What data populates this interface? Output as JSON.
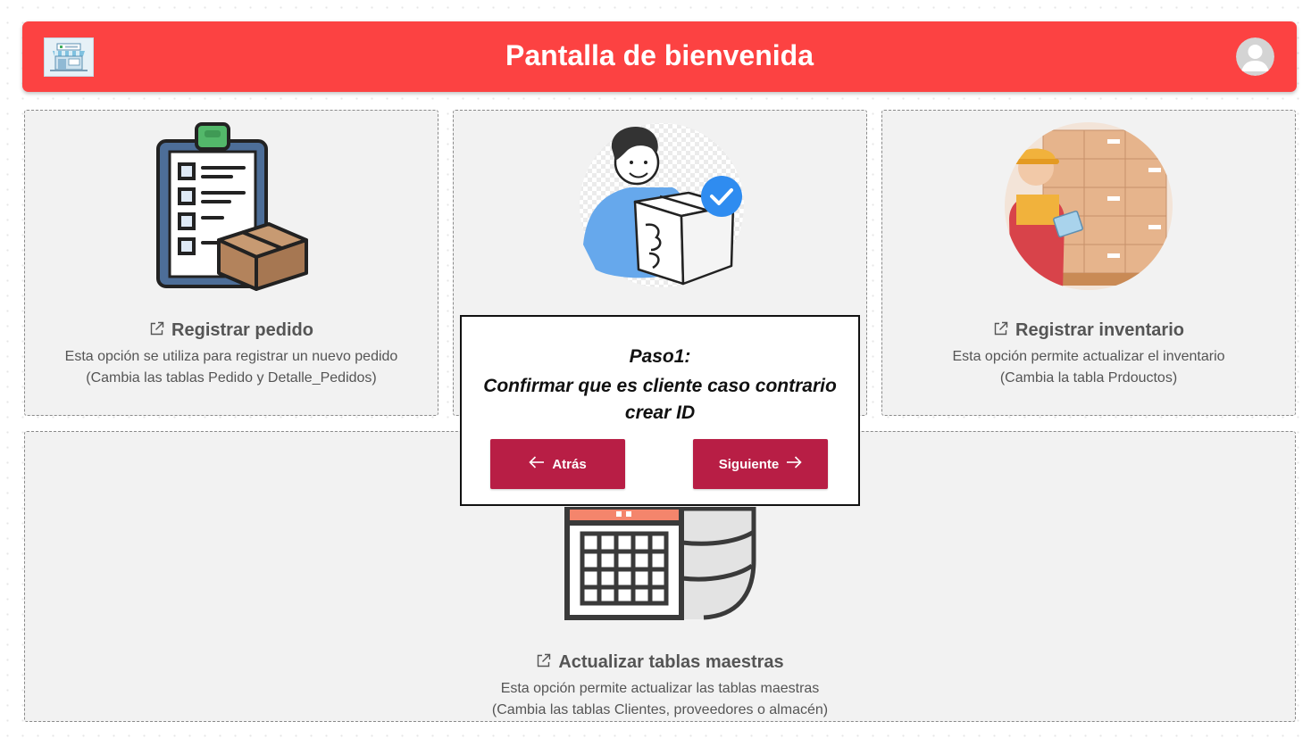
{
  "header": {
    "title": "Pantalla de bienvenida",
    "background_color": "#fc4242",
    "logo_icon": "store-icon",
    "avatar_icon": "user-avatar-icon"
  },
  "cards": [
    {
      "title": "Registrar pedido",
      "description_line1": "Esta opción se utiliza para registrar un nuevo pedido",
      "description_line2": "(Cambia las tablas Pedido y Detalle_Pedidos)",
      "illustration": "clipboard-box-icon"
    },
    {
      "title": "",
      "description_line1": "",
      "description_line2": "",
      "illustration": "person-holding-box-icon"
    },
    {
      "title": "Registrar inventario",
      "description_line1": "Esta opción permite actualizar el inventario",
      "description_line2": "(Cambia la tabla Prdouctos)",
      "illustration": "warehouse-worker-icon"
    },
    {
      "title": "Actualizar tablas maestras",
      "description_line1": "Esta opción permite actualizar las tablas maestras",
      "description_line2": "(Cambia las tablas Clientes, proveedores o almacén)",
      "illustration": "calendar-database-icon"
    }
  ],
  "modal": {
    "step": "Paso1:",
    "message": "Confirmar que es cliente caso contrario crear ID",
    "back_label": "Atrás",
    "next_label": "Siguiente",
    "button_color": "#b81e45"
  }
}
